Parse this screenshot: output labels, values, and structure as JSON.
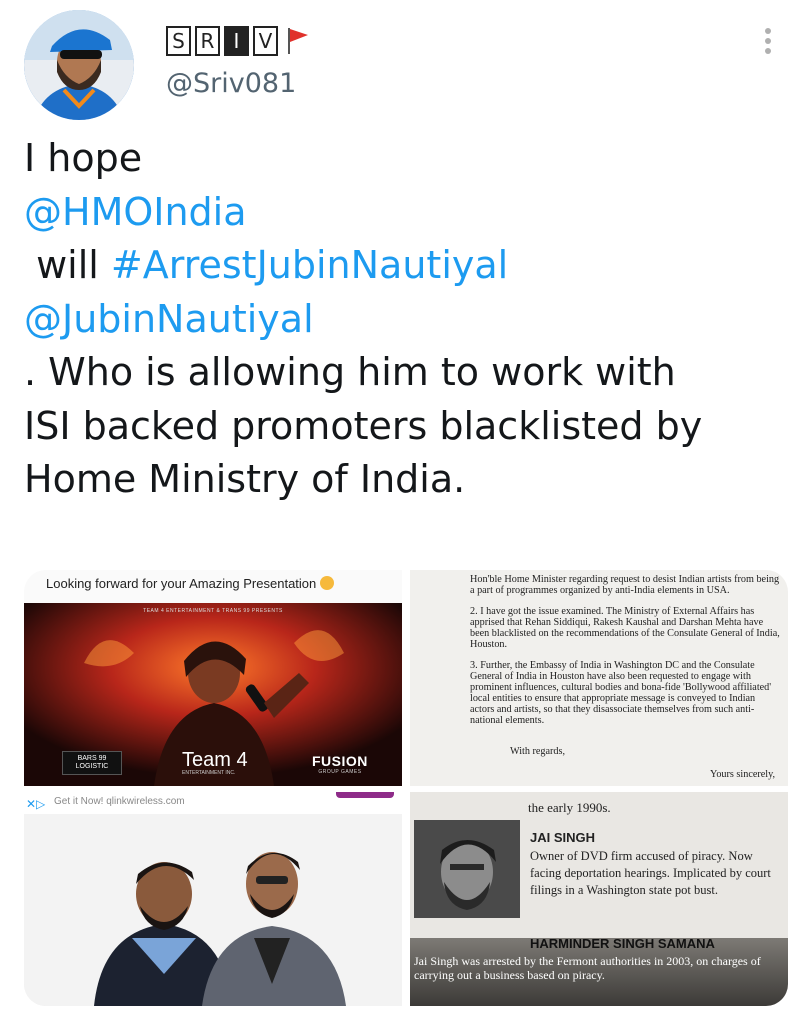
{
  "author": {
    "display_name_letters": [
      "S",
      "R",
      "I",
      "V"
    ],
    "handle": "@Sriv081"
  },
  "tweet": {
    "line1": "I hope",
    "mention1": "@HMOIndia",
    "line3_prefix": " will ",
    "hashtag": "#ArrestJubinNautiyal",
    "mention2": "@JubinNautiyal",
    "line5": ". Who is allowing him to work with",
    "line6": "ISI backed promoters blacklisted by",
    "line7": "Home Ministry of India."
  },
  "media": {
    "promo": {
      "caption": "Looking forward for your Amazing Presentation",
      "poster_small_text": "TEAM 4 ENTERTAINMENT & TRANS 99 PRESENTS",
      "logo_left": "BARS 99 LOGISTIC",
      "logo_team": "Team 4",
      "logo_team_sub": "ENTERTAINMENT INC.",
      "logo_fusion": "FUSION",
      "logo_fusion_sub": "GROUP GAMES"
    },
    "letter": {
      "p1": "Hon'ble Home Minister regarding request to desist Indian artists from being a part of programmes organized by anti-India elements in USA.",
      "p2": "2.     I have got the issue examined. The Ministry of External Affairs has apprised that Rehan Siddiqui, Rakesh Kaushal and Darshan Mehta have been blacklisted on the recommendations of the Consulate General of India, Houston.",
      "p3": "3.     Further, the Embassy of India in Washington DC and the Consulate General of India in Houston have also been requested to engage with prominent influences, cultural bodies and bona-fide 'Bollywood affiliated' local entities to ensure that appropriate message is conveyed to Indian actors and artists, so that they disassociate themselves from such anti-national elements.",
      "regards": "With regards,",
      "sincerely": "Yours sincerely,"
    },
    "ad": {
      "text": "Get it Now! qlinkwireless.com"
    },
    "clipping": {
      "top_text": "the early 1990s.",
      "name": "JAI SINGH",
      "desc": "Owner of DVD firm accused of piracy. Now facing deportation hearings. Implicated by court filings in a Washington state pot bust.",
      "heading": "HARMINDER SINGH SAMANA",
      "caption": "Jai Singh was arrested by the Fermont authorities in 2003, on charges of carrying out a business based on piracy."
    }
  }
}
